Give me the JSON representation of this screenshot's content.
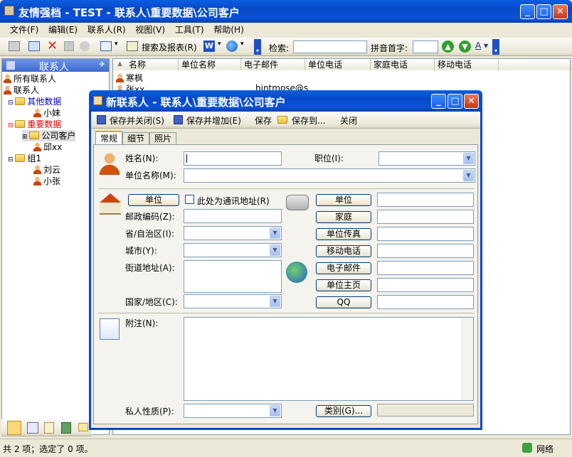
{
  "main_window": {
    "title": "友情强档 - TEST - 联系人\\重要数据\\公司客户"
  },
  "menu": [
    "文件(F)",
    "编辑(E)",
    "联系人(R)",
    "视图(V)",
    "工具(T)",
    "帮助(H)"
  ],
  "toolbar": {
    "search_report": "搜索及报表(R)",
    "search_label": "检索:",
    "pinyin_label": "拼音首字:"
  },
  "sidebar": {
    "header": "联系人",
    "tree": {
      "all": "所有联系人",
      "contacts": "联系人",
      "other": "其他数据",
      "xiaomei": "小妹",
      "important": "重要数据",
      "company": "公司客户",
      "qiuxx": "邱xx",
      "group1": "组1",
      "liuyun": "刘云",
      "xiaozhang": "小张"
    }
  },
  "list": {
    "headers": [
      "名称",
      "单位名称",
      "电子邮件",
      "单位电话",
      "家庭电话",
      "移动电话"
    ],
    "rows": [
      {
        "name": "寒枫"
      },
      {
        "name": "张xx",
        "email": "hintmose@s"
      }
    ]
  },
  "status": {
    "text": "共 2 项；选定了 0 项。",
    "network": "网络"
  },
  "dialog": {
    "title": "新联系人 - 联系人\\重要数据\\公司客户",
    "toolbar": {
      "save_close": "保存并关闭(S)",
      "save_add": "保存并增加(E)",
      "save": "保存",
      "save_to": "保存到...",
      "close": "关闭"
    },
    "tabs": [
      "常规",
      "细节",
      "照片"
    ],
    "labels": {
      "name": "姓名(N):",
      "title": "职位(I):",
      "company": "单位名称(M):",
      "zip": "邮政编码(Z):",
      "province": "省/自治区(I):",
      "city": "城市(Y):",
      "street": "街道地址(A):",
      "country": "国家/地区(C):",
      "notes": "附注(N):",
      "privacy": "私人性质(P):",
      "mailing": "此处为通讯地址(R)"
    },
    "buttons": {
      "address_type": "单位",
      "phone1": "单位",
      "phone2": "家庭",
      "phone3": "单位传真",
      "phone4": "移动电话",
      "email": "电子邮件",
      "homepage": "单位主页",
      "qq": "QQ",
      "category": "类别(G)..."
    }
  }
}
